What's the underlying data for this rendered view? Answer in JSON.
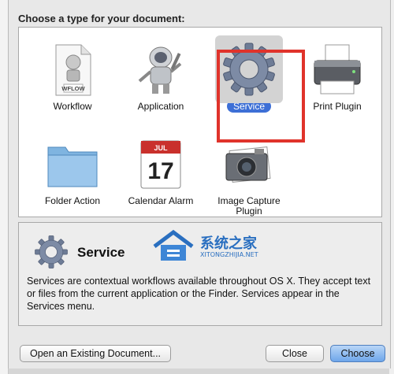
{
  "header": {
    "title": "Choose a type for your document:"
  },
  "types": [
    {
      "label": "Workflow",
      "icon": "workflow-document-icon",
      "badge": "WFLOW"
    },
    {
      "label": "Application",
      "icon": "automator-robot-icon"
    },
    {
      "label": "Service",
      "icon": "gear-icon",
      "selected": true
    },
    {
      "label": "Print Plugin",
      "icon": "printer-icon"
    },
    {
      "label": "Folder Action",
      "icon": "folder-icon"
    },
    {
      "label": "Calendar Alarm",
      "icon": "calendar-icon",
      "month": "JUL",
      "day": "17"
    },
    {
      "label": "Image Capture Plugin",
      "icon": "camera-icon"
    }
  ],
  "description": {
    "title": "Service",
    "body": "Services are contextual workflows available throughout OS X. They accept text or files from the current application or the Finder. Services appear in the Services menu."
  },
  "watermark": {
    "name": "系统之家",
    "url": "XITONGZHIJIA.NET"
  },
  "buttons": {
    "open_existing": "Open an Existing Document...",
    "close": "Close",
    "choose": "Choose"
  },
  "colors": {
    "highlight": "#e0332b",
    "selection": "#3d6fd6"
  }
}
